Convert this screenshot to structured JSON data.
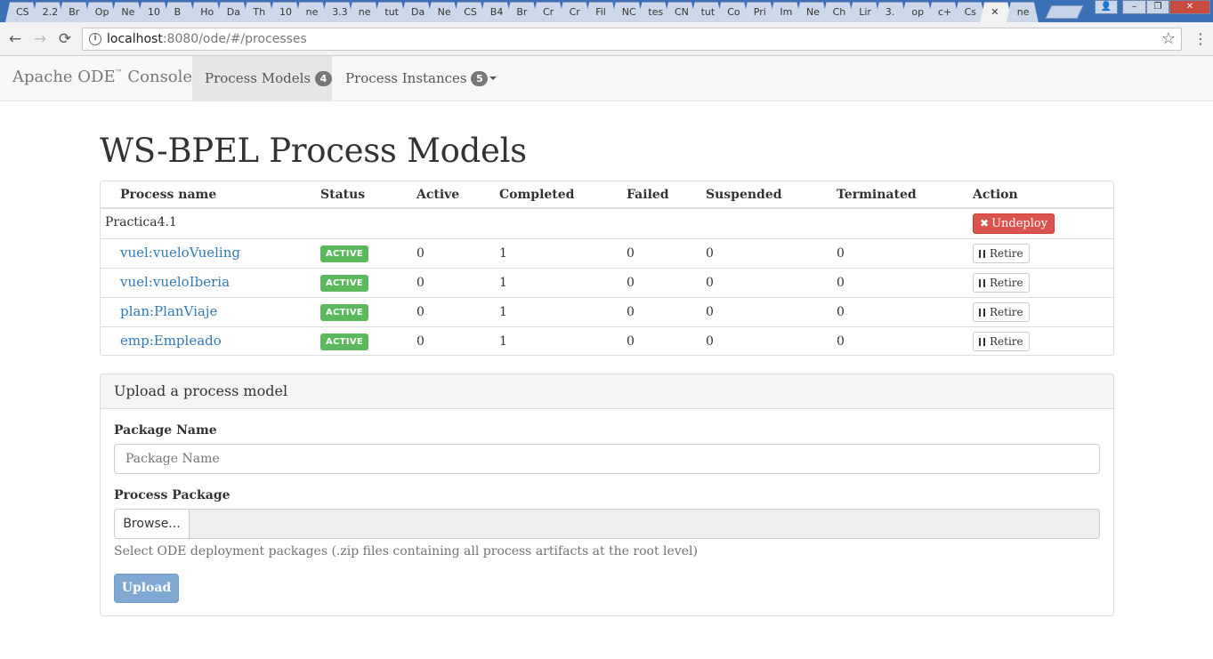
{
  "browser": {
    "tabs": [
      "CS",
      "2.2",
      "Br",
      "Op",
      "Ne",
      "10",
      "B",
      "Ho",
      "Da",
      "Th",
      "10",
      "ne",
      "3.3",
      "ne",
      "tut",
      "Da",
      "Ne",
      "CS",
      "B4",
      "Br",
      "Cr",
      "Cr",
      "Fil",
      "NC",
      "tes",
      "CN",
      "tut",
      "Co",
      "Pri",
      "Im",
      "Ne",
      "Ch",
      "Lir",
      "3.",
      "op",
      "c+",
      "Cs",
      "",
      "ne"
    ],
    "active_tab_close": "✕",
    "url_host": "localhost",
    "url_path": ":8080/ode/#/processes",
    "back_icon": "←",
    "forward_icon": "→",
    "reload_icon": "⟳",
    "info_icon": "i",
    "star_icon": "☆",
    "menu_icon": "⋮",
    "window_controls": [
      "👤",
      "–",
      "❐",
      "✕"
    ]
  },
  "navbar": {
    "brand_name": "Apache ODE",
    "brand_tm": "™",
    "brand_suffix": " Console",
    "items": [
      {
        "label": "Process Models",
        "badge": "4"
      },
      {
        "label": "Process Instances",
        "badge": "5"
      }
    ]
  },
  "page": {
    "title": "WS-BPEL Process Models"
  },
  "table": {
    "headers": [
      "Process name",
      "Status",
      "Active",
      "Completed",
      "Failed",
      "Suspended",
      "Terminated",
      "Action"
    ],
    "package": {
      "name": "Practica4.1",
      "action": "Undeploy",
      "action_icon": "✖"
    },
    "rows": [
      {
        "name": "vuel:vueloVueling",
        "status": "ACTIVE",
        "active": "0",
        "completed": "1",
        "failed": "0",
        "suspended": "0",
        "terminated": "0",
        "action": "Retire"
      },
      {
        "name": "vuel:vueloIberia",
        "status": "ACTIVE",
        "active": "0",
        "completed": "1",
        "failed": "0",
        "suspended": "0",
        "terminated": "0",
        "action": "Retire"
      },
      {
        "name": "plan:PlanViaje",
        "status": "ACTIVE",
        "active": "0",
        "completed": "1",
        "failed": "0",
        "suspended": "0",
        "terminated": "0",
        "action": "Retire"
      },
      {
        "name": "emp:Empleado",
        "status": "ACTIVE",
        "active": "0",
        "completed": "1",
        "failed": "0",
        "suspended": "0",
        "terminated": "0",
        "action": "Retire"
      }
    ]
  },
  "upload": {
    "heading": "Upload a process model",
    "package_name_label": "Package Name",
    "package_name_placeholder": "Package Name",
    "package_name_value": "",
    "process_package_label": "Process Package",
    "browse_label": "Browse...",
    "help": "Select ODE deployment packages (.zip files containing all process artifacts at the root level)",
    "submit_label": "Upload"
  },
  "colors": {
    "active_label": "#5cb85c",
    "danger": "#d9534f",
    "primary_disabled": "#7fa8d2",
    "link": "#337ab7"
  }
}
